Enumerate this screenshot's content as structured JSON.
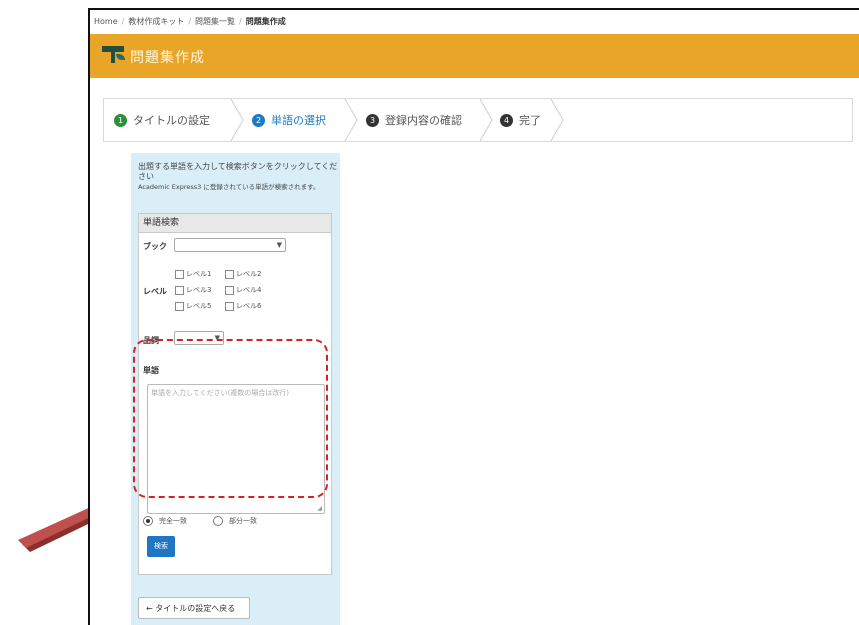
{
  "breadcrumb": {
    "home": "Home",
    "item2": "教材作成キット",
    "item3": "問題集一覧",
    "current": "問題集作成"
  },
  "header": {
    "title": "問題集作成",
    "bg_color": "#e9a527"
  },
  "steps": [
    {
      "num": "1",
      "label": "タイトルの設定"
    },
    {
      "num": "2",
      "label": "単語の選択"
    },
    {
      "num": "3",
      "label": "登録内容の確認"
    },
    {
      "num": "4",
      "label": "完了"
    }
  ],
  "instructions": {
    "line1": "出題する単語を入力して検索ボタンをクリックしてください",
    "line2": "Academic Express3 に登録されている単語が検索されます。"
  },
  "search_panel": {
    "header": "単語検索",
    "book_label": "ブック",
    "level_label": "レベル",
    "levels": [
      "レベル1",
      "レベル2",
      "レベル3",
      "レベル4",
      "レベル5",
      "レベル6"
    ],
    "pos_label": "品詞",
    "word_label": "単語",
    "word_placeholder": "単語を入力してください(複数の場合は改行)",
    "match_exact": "完全一致",
    "match_partial": "部分一致",
    "search_button": "検索"
  },
  "back_button": "← タイトルの設定へ戻る",
  "annotation": {
    "arrow_color": "#c0504d",
    "highlight_color": "#d62222"
  }
}
